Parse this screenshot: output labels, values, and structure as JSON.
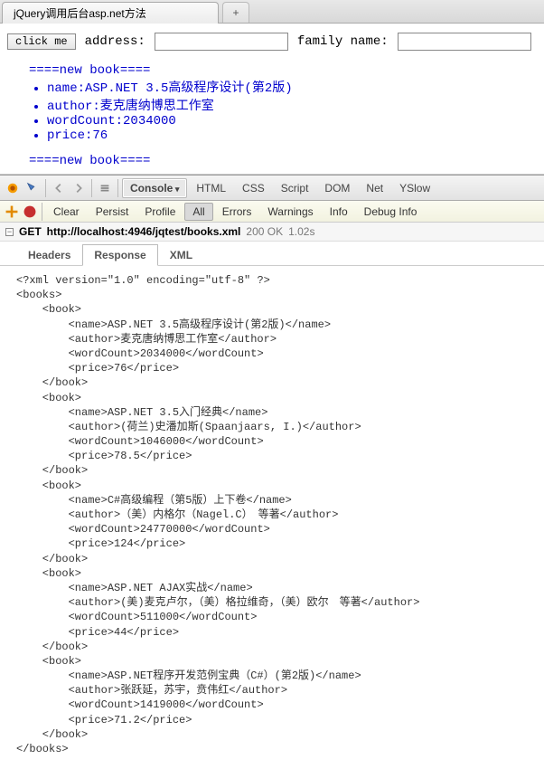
{
  "browser": {
    "tab_title": "jQuery调用后台asp.net方法",
    "newtab_glyph": "+"
  },
  "form": {
    "button_label": "click me",
    "address_label": "address:",
    "family_label": "family name:",
    "address_value": "",
    "family_value": ""
  },
  "content": {
    "separator": "====new book====",
    "items": [
      "name:ASP.NET 3.5高级程序设计(第2版)",
      "author:麦克唐纳博思工作室",
      "wordCount:2034000",
      "price:76"
    ],
    "separator2": "====new book===="
  },
  "devtools": {
    "tabs": [
      "Console",
      "HTML",
      "CSS",
      "Script",
      "DOM",
      "Net",
      "YSlow"
    ],
    "active_tab": 0,
    "subtabs": [
      "Clear",
      "Persist",
      "Profile",
      "All",
      "Errors",
      "Warnings",
      "Info",
      "Debug Info"
    ],
    "sub_active": 3
  },
  "request": {
    "method": "GET",
    "url": "http://localhost:4946/jqtest/books.xml",
    "status": "200 OK",
    "time": "1.02s"
  },
  "response_tabs": [
    "Headers",
    "Response",
    "XML"
  ],
  "response_active": 1,
  "xml": "<?xml version=\"1.0\" encoding=\"utf-8\" ?>\n<books>\n    <book>\n        <name>ASP.NET 3.5高级程序设计(第2版)</name>\n        <author>麦克唐纳博思工作室</author>\n        <wordCount>2034000</wordCount>\n        <price>76</price>\n    </book>\n    <book>\n        <name>ASP.NET 3.5入门经典</name>\n        <author>(荷兰)史潘加斯(Spaanjaars, I.)</author>\n        <wordCount>1046000</wordCount>\n        <price>78.5</price>\n    </book>\n    <book>\n        <name>C#高级编程（第5版）上下卷</name>\n        <author>（美）内格尔（Nagel.C）　等著</author>\n        <wordCount>24770000</wordCount>\n        <price>124</price>\n    </book>\n    <book>\n        <name>ASP.NET AJAX实战</name>\n        <author>(美)麦克卢尔，（美）格拉维奇，（美）欧尔　等著</author>\n        <wordCount>511000</wordCount>\n        <price>44</price>\n    </book>\n    <book>\n        <name>ASP.NET程序开发范例宝典（C#）(第2版)</name>\n        <author>张跃延，苏宇，贲伟红</author>\n        <wordCount>1419000</wordCount>\n        <price>71.2</price>\n    </book>\n</books>",
  "chart_data": {
    "type": "table",
    "title": "books.xml",
    "columns": [
      "name",
      "author",
      "wordCount",
      "price"
    ],
    "rows": [
      [
        "ASP.NET 3.5高级程序设计(第2版)",
        "麦克唐纳博思工作室",
        2034000,
        76
      ],
      [
        "ASP.NET 3.5入门经典",
        "(荷兰)史潘加斯(Spaanjaars, I.)",
        1046000,
        78.5
      ],
      [
        "C#高级编程（第5版）上下卷",
        "（美）内格尔（Nagel.C）　等著",
        24770000,
        124
      ],
      [
        "ASP.NET AJAX实战",
        "(美)麦克卢尔，（美）格拉维奇，（美）欧尔　等著",
        511000,
        44
      ],
      [
        "ASP.NET程序开发范例宝典（C#）(第2版)",
        "张跃延，苏宇，贲伟红",
        1419000,
        71.2
      ]
    ]
  }
}
